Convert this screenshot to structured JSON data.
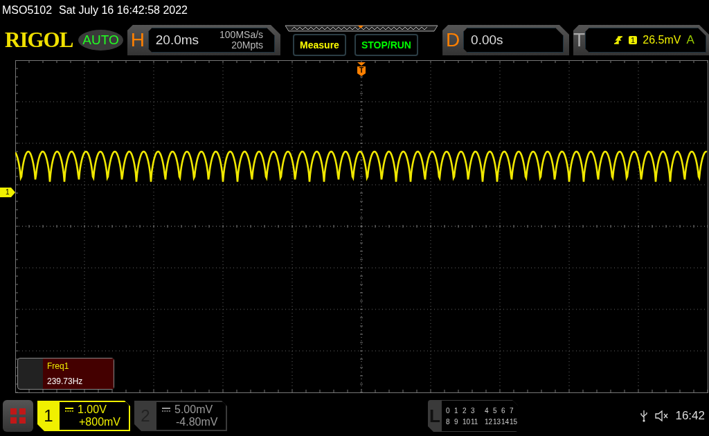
{
  "status_line": {
    "model": "MSO5102",
    "datetime": "Sat July 16 16:42:58 2022"
  },
  "header": {
    "logo": "RIGOL",
    "mode": "AUTO",
    "horizontal": {
      "label": "H",
      "timebase": "20.0ms",
      "sample_rate": "100MSa/s",
      "memory_depth": "20Mpts"
    },
    "buttons": [
      {
        "label": "Measure",
        "color": "#ffff00"
      },
      {
        "label": "STOP/RUN",
        "color": "#00ff00"
      }
    ],
    "delay": {
      "label": "D",
      "value": "0.00s"
    },
    "trigger": {
      "label": "T",
      "source": "1",
      "level": "26.5mV",
      "sweep": "A"
    }
  },
  "display": {
    "trigger_marker": "T",
    "channel_marker": "1",
    "measurement": {
      "name": "Freq1",
      "value": "239.73Hz"
    }
  },
  "channels": [
    {
      "number": "1",
      "scale": "1.00V",
      "offset": "+800mV",
      "on": true
    },
    {
      "number": "2",
      "scale": "5.00mV",
      "offset": "-4.80mV",
      "on": false
    }
  ],
  "logic": {
    "label": "L",
    "rows": [
      [
        "0",
        "1",
        "2",
        "3",
        "4",
        "5",
        "6",
        "7"
      ],
      [
        "8",
        "9",
        "10",
        "11",
        "12",
        "13",
        "14",
        "15"
      ]
    ]
  },
  "status": {
    "time": "16:42"
  }
}
